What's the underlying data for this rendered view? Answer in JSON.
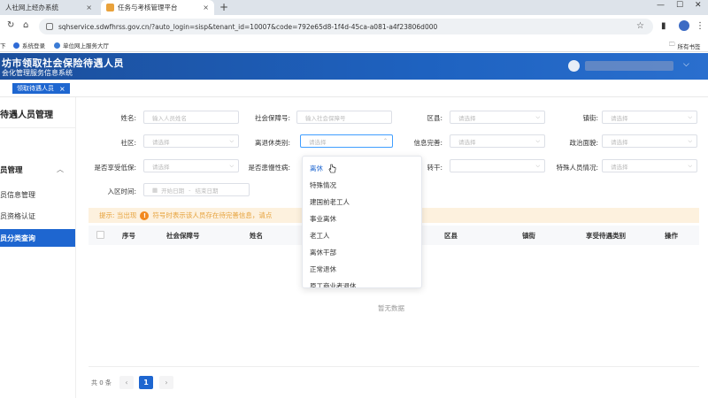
{
  "browser": {
    "tabs": [
      {
        "title": "人社网上经办系统"
      },
      {
        "title": "任务与考核管理平台"
      }
    ],
    "url": "sqhservice.sdwfhrss.gov.cn/?auto_login=sisp&tenant_id=10007&code=792e65d8-1f4d-45ca-a081-a4f23806d000",
    "bookmarks": [
      {
        "label": "下"
      },
      {
        "label": "系统登录"
      },
      {
        "label": "单位网上服务大厅"
      },
      {
        "label": "所有书签"
      }
    ]
  },
  "app": {
    "title": "坊市领取社会保险待遇人员",
    "subtitle": "会化管理服务信息系统",
    "active_tag": "领取待遇人员",
    "accent_color": "#1e66d0"
  },
  "sidebar": {
    "title": "待遇人员管理",
    "group": "员管理",
    "items": [
      {
        "label": "员信息管理"
      },
      {
        "label": "员资格认证"
      },
      {
        "label": "员分类查询"
      }
    ]
  },
  "filters": {
    "name_label": "姓名:",
    "name_placeholder": "输入人员姓名",
    "ssn_label": "社会保障号:",
    "ssn_placeholder": "输入社会保障号",
    "district_label": "区县:",
    "district_placeholder": "请选择",
    "street_label": "镇街:",
    "street_placeholder": "请选择",
    "community_label": "社区:",
    "community_placeholder": "请选择",
    "retire_type_label": "离退休类别:",
    "retire_type_placeholder": "请选择",
    "info_label": "信息完善:",
    "info_placeholder": "请选择",
    "politics_label": "政治面貌:",
    "politics_placeholder": "请选择",
    "lowincome_label": "是否享受低保:",
    "lowincome_placeholder": "请选择",
    "chronic_label": "是否患慢性病:",
    "chronic_placeholder": "请选择",
    "transfer_label": "转干:",
    "special_label": "特殊人员情况:",
    "special_placeholder": "请选择",
    "entry_label": "入区时间:",
    "date_start": "开始日期",
    "date_sep": "-",
    "date_end": "结束日期"
  },
  "dropdown_options": [
    "离休",
    "特殊情况",
    "建国前老工人",
    "事业离休",
    "老工人",
    "离休干部",
    "正常退休",
    "原工商业者退休"
  ],
  "tip": {
    "prefix": "提示: 当出现",
    "text": "符号时表示该人员存在待完善信息，请点"
  },
  "table": {
    "columns": [
      "序号",
      "社会保障号",
      "姓名",
      "区县",
      "镇街",
      "享受待遇类别",
      "操作"
    ],
    "empty_text": "暂无数据"
  },
  "pagination": {
    "total": "共 0 条",
    "prev": "‹",
    "current": "1",
    "next": "›"
  }
}
